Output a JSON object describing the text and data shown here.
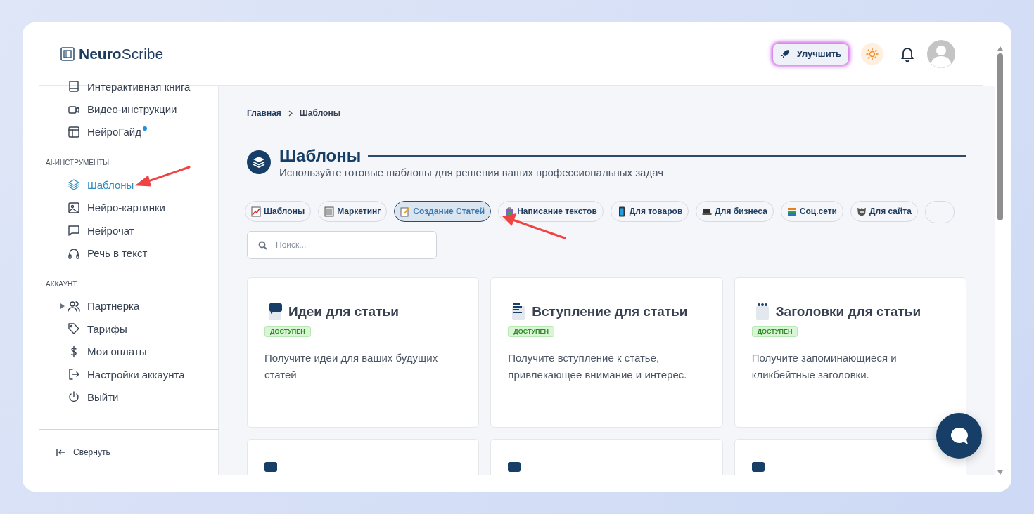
{
  "logo": {
    "bold": "Neuro",
    "light": "Scribe"
  },
  "header": {
    "upgrade_button": "Улучшить"
  },
  "sidebar": {
    "groups": [
      {
        "items": [
          {
            "label": "Интерактивная книга",
            "selected": false,
            "unread": false
          },
          {
            "label": "Видео-инструкции",
            "selected": false,
            "unread": false
          },
          {
            "label": "НейроГайд",
            "selected": false,
            "unread": true
          }
        ]
      },
      {
        "heading": "AI-ИНСТРУМЕНТЫ",
        "items": [
          {
            "label": "Шаблоны",
            "selected": true,
            "unread": false
          },
          {
            "label": "Нейро-картинки",
            "selected": false,
            "unread": false
          },
          {
            "label": "Нейрочат",
            "selected": false,
            "unread": false
          },
          {
            "label": "Речь в текст",
            "selected": false,
            "unread": false
          }
        ]
      },
      {
        "heading": "АККАУНТ",
        "items": [
          {
            "label": "Партнерка",
            "selected": false,
            "unread": false,
            "expanded": false
          },
          {
            "label": "Тарифы",
            "selected": false,
            "unread": false
          },
          {
            "label": "Мои оплаты",
            "selected": false,
            "unread": false
          },
          {
            "label": "Настройки аккаунта",
            "selected": false,
            "unread": false
          },
          {
            "label": "Выйти",
            "selected": false,
            "unread": false
          }
        ]
      }
    ],
    "collapse": "Свернуть"
  },
  "breadcrumb": [
    "Главная",
    "Шаблоны"
  ],
  "page": {
    "title": "Шаблоны",
    "subtitle": "Используйте готовые шаблоны для решения ваших профессиональных задач"
  },
  "filters": [
    {
      "label": "Шаблоны",
      "selected": false
    },
    {
      "label": "Маркетинг",
      "selected": false
    },
    {
      "label": "Создание Статей",
      "selected": true
    },
    {
      "label": "Написание текстов",
      "selected": false
    },
    {
      "label": "Для товаров",
      "selected": false
    },
    {
      "label": "Для бизнеса",
      "selected": false
    },
    {
      "label": "Соц.сети",
      "selected": false
    },
    {
      "label": "Для сайта",
      "selected": false
    }
  ],
  "search": {
    "placeholder": "Поиск..."
  },
  "cards": [
    {
      "title": "Идеи для статьи",
      "badge": "ДОСТУПЕН",
      "description": "Получите идеи для ваших будущих статей"
    },
    {
      "title": "Вступление для статьи",
      "badge": "ДОСТУПЕН",
      "description": "Получите вступление к статье, привлекающее внимание и интерес."
    },
    {
      "title": "Заголовки для статьи",
      "badge": "ДОСТУПЕН",
      "description": "Получите запоминающиеся и кликбейтные заголовки."
    }
  ]
}
